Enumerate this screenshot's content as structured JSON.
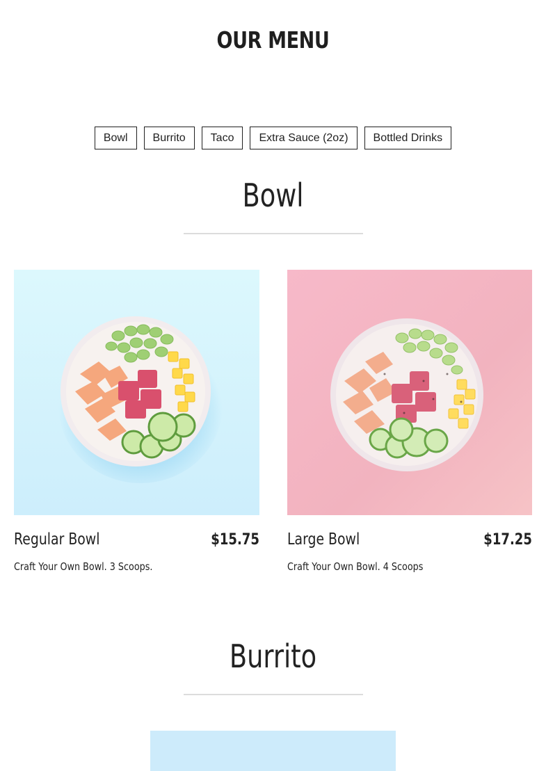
{
  "header": {
    "title": "OUR MENU"
  },
  "nav": {
    "categories": [
      "Bowl",
      "Burrito",
      "Taco",
      "Extra Sauce (2oz)",
      "Bottled Drinks"
    ]
  },
  "sections": [
    {
      "title": "Bowl",
      "items": [
        {
          "name": "Regular Bowl",
          "price": "$15.75",
          "description": "Craft Your Own Bowl. 3 Scoops.",
          "image_bg": "#d6f4fd"
        },
        {
          "name": "Large Bowl",
          "price": "$17.25",
          "description": "Craft Your Own Bowl. 4 Scoops",
          "image_bg": "#f4b8c4"
        }
      ]
    },
    {
      "title": "Burrito",
      "items": [
        {
          "image_bg": "#cdebfb"
        }
      ]
    }
  ]
}
